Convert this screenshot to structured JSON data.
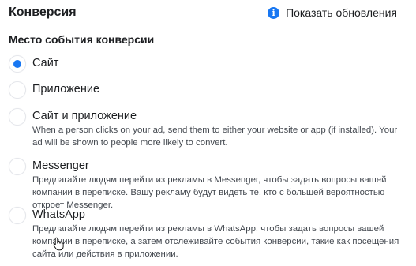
{
  "header": {
    "title": "Конверсия",
    "show_updates_label": "Показать обновления",
    "info_icon_glyph": "i"
  },
  "section": {
    "label": "Место события конверсии"
  },
  "options": [
    {
      "label": "Сайт",
      "description": "",
      "checked": true
    },
    {
      "label": "Приложение",
      "description": "",
      "checked": false
    },
    {
      "label": "Сайт и приложение",
      "description": "When a person clicks on your ad, send them to either your website or app (if installed). Your ad will be shown to people more likely to convert.",
      "checked": false
    },
    {
      "label": "Messenger",
      "description": "Предлагайте людям перейти из рекламы в Messenger, чтобы задать вопросы вашей компании в переписке. Вашу рекламу будут видеть те, кто с большей вероятностью откроет Messenger.",
      "checked": false
    },
    {
      "label": "WhatsApp",
      "description": "Предлагайте людям перейти из рекламы в WhatsApp, чтобы задать вопросы вашей компании в переписке, а затем отслеживайте события конверсии, такие как посещения сайта или действия в приложении.",
      "checked": false
    }
  ],
  "colors": {
    "accent": "#1877f2",
    "text": "#1c1e21",
    "secondary_text": "#444950"
  }
}
